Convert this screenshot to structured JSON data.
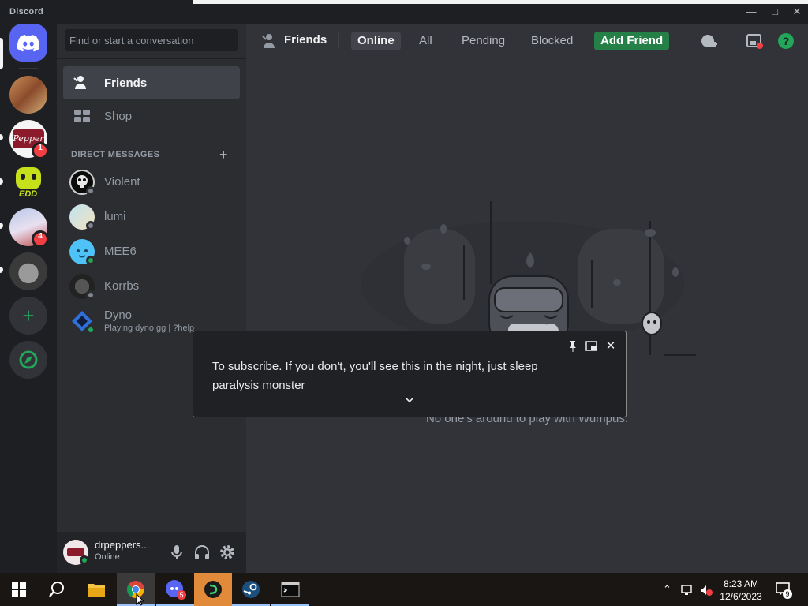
{
  "window": {
    "title": "Discord"
  },
  "rail": {
    "servers": [
      {
        "name": "home",
        "badge": ""
      },
      {
        "name": "server-1",
        "badge": ""
      },
      {
        "name": "dr-pepper",
        "badge": "1"
      },
      {
        "name": "edd",
        "badge": ""
      },
      {
        "name": "server-4",
        "badge": "4"
      },
      {
        "name": "server-5",
        "badge": ""
      }
    ]
  },
  "sidebar": {
    "search_placeholder": "Find or start a conversation",
    "friends_label": "Friends",
    "shop_label": "Shop",
    "dm_header": "DIRECT MESSAGES",
    "dm_add": "+",
    "dms": [
      {
        "name": "Violent",
        "activity": ""
      },
      {
        "name": "lumi",
        "activity": ""
      },
      {
        "name": "MEE6",
        "activity": ""
      },
      {
        "name": "Korrbs",
        "activity": ""
      },
      {
        "name": "Dyno",
        "activity": "Playing dyno.gg | ?help"
      }
    ],
    "user": {
      "name": "drpeppers...",
      "status": "Online"
    }
  },
  "main": {
    "title": "Friends",
    "tabs": {
      "online": "Online",
      "all": "All",
      "pending": "Pending",
      "blocked": "Blocked",
      "add_friend": "Add Friend"
    },
    "empty_message": "No one's around to play with Wumpus."
  },
  "popup": {
    "text": "To subscribe. If you don't, you'll see this in the night, just sleep paralysis monster"
  },
  "taskbar": {
    "time": "8:23 AM",
    "date": "12/6/2023",
    "discord_badge": "5",
    "notification_count": "9"
  },
  "colors": {
    "accent_green": "#248046",
    "status_online": "#23a55a",
    "badge_red": "#f23f43",
    "blurple": "#5865f2"
  }
}
